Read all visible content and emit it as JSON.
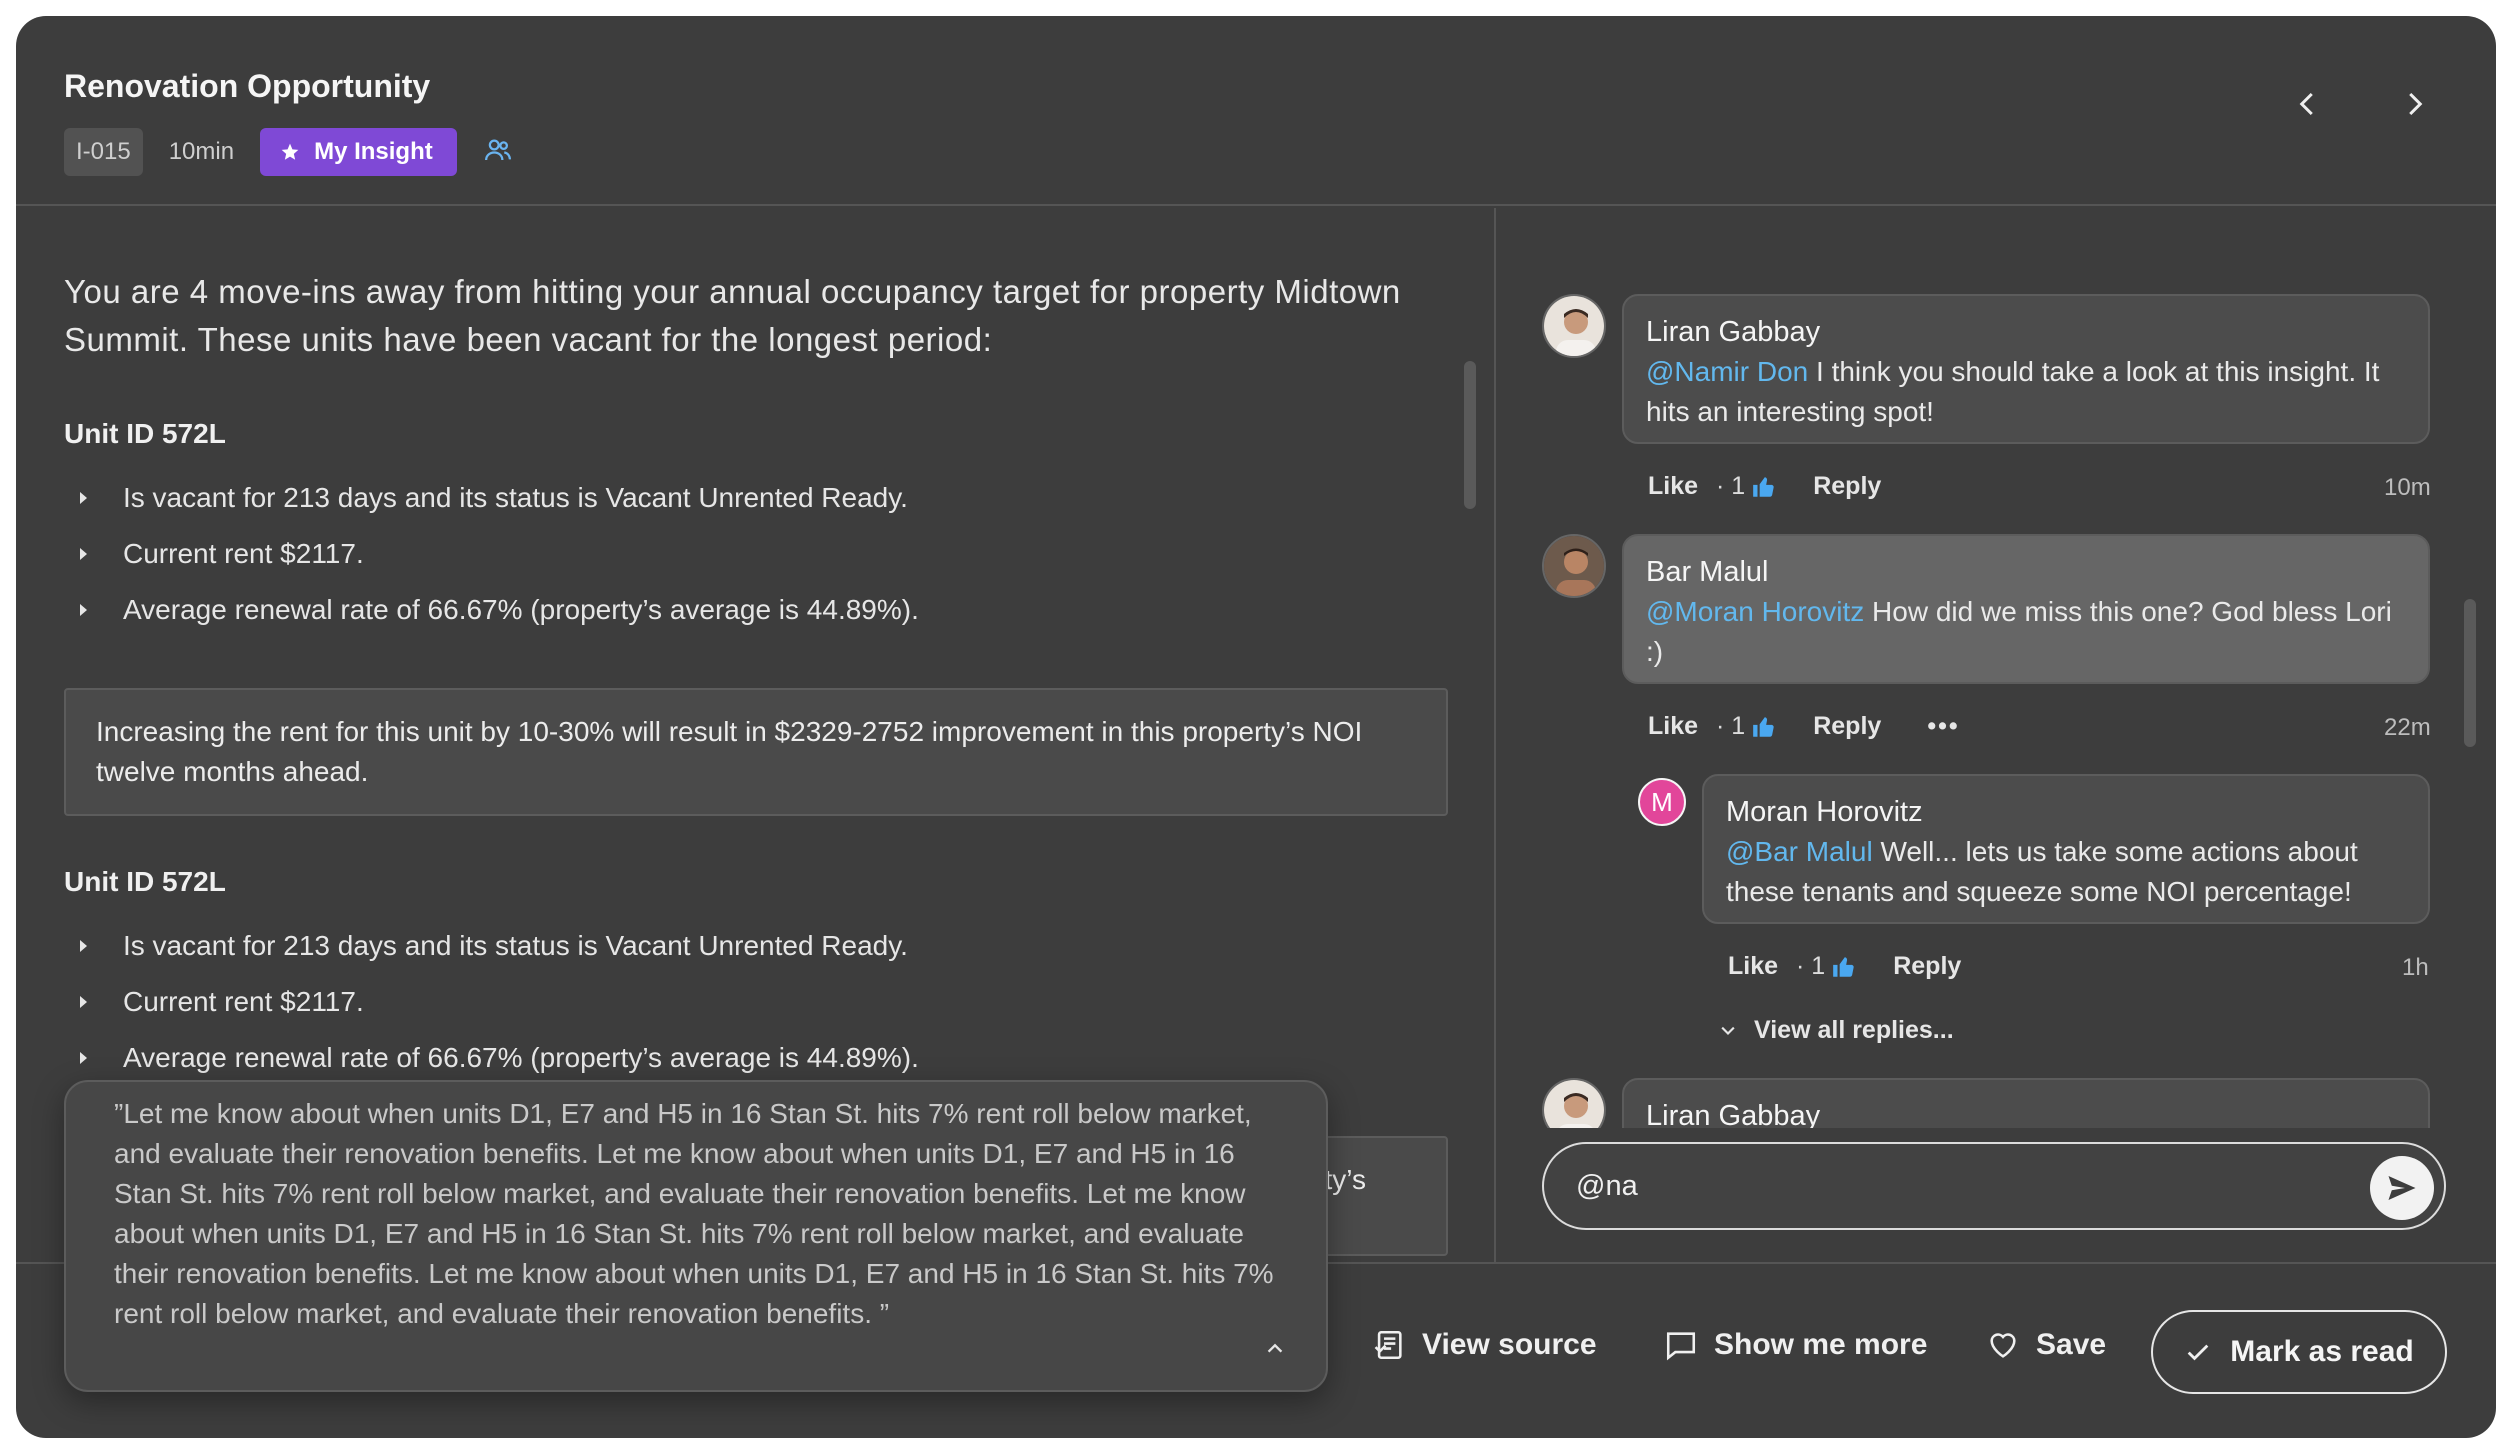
{
  "header": {
    "title": "Renovation Opportunity",
    "id": "I-015",
    "time": "10min",
    "insight_label": "My Insight"
  },
  "insight": {
    "intro": "You are 4 move-ins away from hitting your annual occupancy target for property Midtown Summit. These units have been vacant for the longest period:",
    "units": [
      {
        "title": "Unit ID 572L",
        "bullets": [
          "Is vacant for 213 days and its status is Vacant Unrented Ready.",
          "Current rent $2117.",
          "Average renewal rate of 66.67% (property’s average is 44.89%)."
        ],
        "callout": "Increasing the rent for this unit by 10-30% will result in $2329-2752 improvement in this property’s NOI twelve months ahead."
      },
      {
        "title": "Unit ID 572L",
        "bullets": [
          "Is vacant for 213 days and its status is Vacant Unrented Ready.",
          "Current rent $2117.",
          "Average renewal rate of 66.67% (property’s average is 44.89%)."
        ],
        "callout_tail": "rty’s"
      }
    ]
  },
  "popover": {
    "text": "”Let me know about when units D1, E7 and H5 in 16 Stan St. hits 7% rent roll below market, and evaluate their renovation benefits. Let me know about when units D1, E7 and H5 in 16 Stan St. hits 7% rent roll below market, and evaluate their renovation benefits. Let me know about when units D1, E7 and H5 in 16 Stan St. hits 7% rent roll below market, and evaluate their renovation benefits. Let me know about when units D1, E7 and H5 in 16 Stan St. hits 7% rent roll below market, and evaluate their renovation benefits. ”"
  },
  "comments": [
    {
      "author": "Liran Gabbay",
      "mention": "@Namir Don",
      "text": " I think you should take a look at this insight. It hits an interesting spot!",
      "like": "Like",
      "likes": "· 1",
      "reply": "Reply",
      "time": "10m"
    },
    {
      "author": "Bar Malul",
      "mention": "@Moran Horovitz",
      "text": " How did we miss this one? God bless Lori :)",
      "like": "Like",
      "likes": "· 1",
      "reply": "Reply",
      "more": "•••",
      "time": "22m"
    },
    {
      "author": "Moran Horovitz",
      "avatar_letter": "M",
      "mention": "@Bar Malul",
      "text": " Well... lets us take some actions about these tenants and squeeze some NOI percentage!",
      "like": "Like",
      "likes": "· 1",
      "reply": "Reply",
      "time": "1h"
    },
    {
      "author": "Liran Gabbay"
    }
  ],
  "view_all": "View all replies...",
  "composer": {
    "value": "@na"
  },
  "footer": {
    "view_source": "View source",
    "show_more": "Show me more",
    "save": "Save",
    "mark_read": "Mark as read"
  },
  "colors": {
    "background": "#3d3d3d",
    "accent_purple": "#7f49d6",
    "mention_blue": "#62b8ee",
    "avatar_pink": "#e2469a"
  }
}
